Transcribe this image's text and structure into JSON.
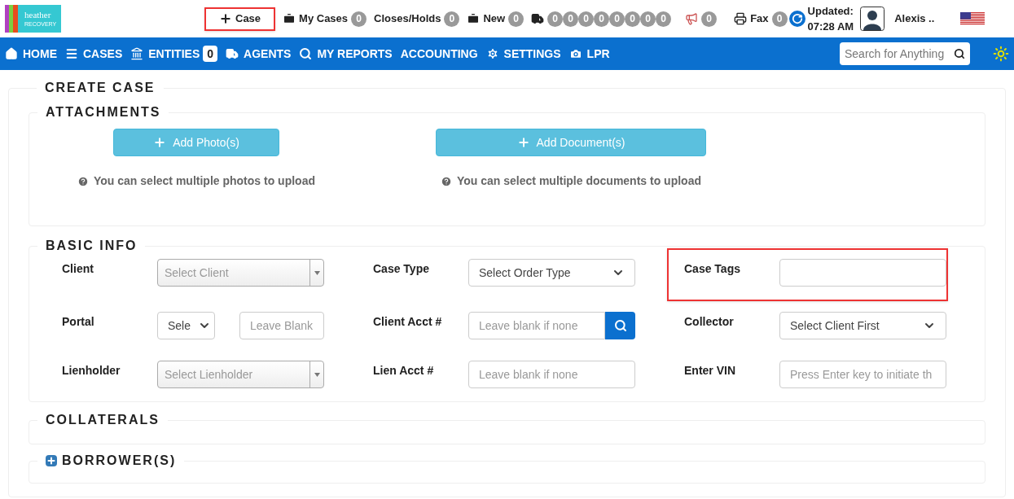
{
  "logo": {
    "name": "heather",
    "sub": "RECOVERY"
  },
  "topbar": [
    {
      "kind": "plus",
      "label": "Case",
      "highlighted": true
    },
    {
      "kind": "briefcase",
      "label": "My Cases",
      "highlighted": false,
      "counts": [
        "0"
      ]
    },
    {
      "kind": "none",
      "label": "Closes/Holds",
      "highlighted": false,
      "counts": [
        "0"
      ]
    },
    {
      "kind": "toolbox",
      "label": "New",
      "highlighted": false,
      "counts": [
        "0"
      ]
    },
    {
      "kind": "truck",
      "highlighted": false,
      "counts": [
        "0",
        "0",
        "0",
        "0",
        "0",
        "0",
        "0",
        "0"
      ]
    },
    {
      "kind": "megaphone",
      "highlighted": false,
      "counts": [
        "0"
      ]
    },
    {
      "kind": "fax",
      "label": "Fax",
      "highlighted": false,
      "counts": [
        "0"
      ]
    }
  ],
  "updated": {
    "label": "Updated:",
    "time": "07:28 AM"
  },
  "user": {
    "name": "Alexis .."
  },
  "nav": [
    {
      "kind": "home",
      "label": "HOME"
    },
    {
      "kind": "menu",
      "label": "CASES"
    },
    {
      "kind": "bank",
      "label": "ENTITIES",
      "count": "0"
    },
    {
      "kind": "truck",
      "label": "AGENTS"
    },
    {
      "kind": "search",
      "label": "MY REPORTS"
    },
    {
      "kind": "none",
      "label": "ACCOUNTING"
    },
    {
      "kind": "gear",
      "label": "SETTINGS"
    },
    {
      "kind": "camera",
      "label": "LPR"
    }
  ],
  "search": {
    "placeholder": "Search for Anything"
  },
  "page_title": "CREATE CASE",
  "attachments": {
    "title": "ATTACHMENTS",
    "items": [
      {
        "button": "Add Photo(s)",
        "hint": "You can select multiple photos to upload"
      },
      {
        "button": "Add Document(s)",
        "hint": "You can select multiple documents to upload"
      }
    ]
  },
  "basic_info": {
    "title": "BASIC INFO",
    "rows": [
      [
        {
          "label": "Client",
          "kind": "combo",
          "placeholder": "Select Client",
          "highlighted": false
        },
        {
          "label": "Case Type",
          "kind": "select",
          "value": "Select Order Type",
          "highlighted": false
        },
        {
          "label": "Case Tags",
          "kind": "input",
          "highlighted": true
        }
      ],
      [
        {
          "label": "Portal",
          "kind": "pair",
          "value": "Sele",
          "placeholder": "Leave Blank",
          "highlighted": false
        },
        {
          "label": "Client Acct #",
          "kind": "search-input",
          "placeholder": "Leave blank if none",
          "highlighted": false
        },
        {
          "label": "Collector",
          "kind": "select",
          "value": "Select Client First",
          "highlighted": false
        }
      ],
      [
        {
          "label": "Lienholder",
          "kind": "combo",
          "placeholder": "Select Lienholder",
          "highlighted": false
        },
        {
          "label": "Lien Acct #",
          "kind": "input",
          "placeholder": "Leave blank if none",
          "highlighted": false
        },
        {
          "label": "Enter VIN",
          "kind": "disabled-input",
          "placeholder": "Press Enter key to initiate th",
          "highlighted": false
        }
      ]
    ]
  },
  "collaterals": {
    "title": "COLLATERALS"
  },
  "borrowers": {
    "title": "BORROWER(S)",
    "expanded": false
  }
}
